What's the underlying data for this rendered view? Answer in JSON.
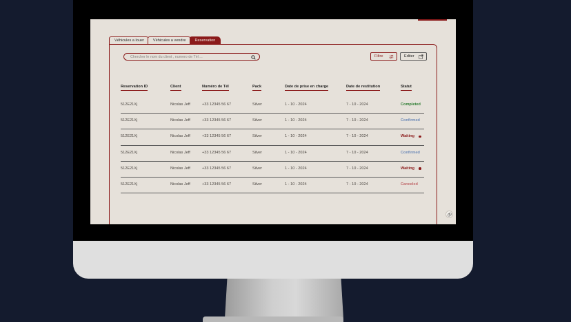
{
  "tabs": [
    {
      "label": "Véhicules a louer",
      "active": false
    },
    {
      "label": "Véhicules a vendre",
      "active": false
    },
    {
      "label": "Reservation",
      "active": true
    }
  ],
  "search": {
    "placeholder": "Chercher le nom du client , numero de Tél ..."
  },
  "toolbar": {
    "filter_label": "Filtre",
    "edit_label": "Editer"
  },
  "table": {
    "headers": [
      "Reservation ID",
      "Client",
      "Numéro de Tél",
      "Pack",
      "Date de prise en charge",
      "Date de restitution",
      "Statut"
    ],
    "rows": [
      {
        "id": "512E21Xj",
        "client": "Nicolas Jeff",
        "phone": "+33 12345 56 67",
        "pack": "Silver",
        "pickup": "1 - 10 - 2024",
        "return": "7 - 10 - 2024",
        "status": "Completed",
        "status_color": "#2e7d32",
        "dot": false
      },
      {
        "id": "512E21Xj",
        "client": "Nicolas Jeff",
        "phone": "+33 12345 56 67",
        "pack": "Silver",
        "pickup": "1 - 10 - 2024",
        "return": "7 - 10 - 2024",
        "status": "Confirmed",
        "status_color": "#6f8bb8",
        "dot": false
      },
      {
        "id": "512E21Xj",
        "client": "Nicolas Jeff",
        "phone": "+33 12345 56 67",
        "pack": "Silver",
        "pickup": "1 - 10 - 2024",
        "return": "7 - 10 - 2024",
        "status": "Waiting",
        "status_color": "#8b1a1a",
        "dot": true
      },
      {
        "id": "512E21Xj",
        "client": "Nicolas Jeff",
        "phone": "+33 12345 56 67",
        "pack": "Silver",
        "pickup": "1 - 10 - 2024",
        "return": "7 - 10 - 2024",
        "status": "Confirmed",
        "status_color": "#6f8bb8",
        "dot": false
      },
      {
        "id": "512E21Xj",
        "client": "Nicolas Jeff",
        "phone": "+33 12345 56 67",
        "pack": "Silver",
        "pickup": "1 - 10 - 2024",
        "return": "7 - 10 - 2024",
        "status": "Waiting",
        "status_color": "#8b1a1a",
        "dot": true
      },
      {
        "id": "512E21Xj",
        "client": "Nicolas Jeff",
        "phone": "+33 12345 56 67",
        "pack": "Silver",
        "pickup": "1 - 10 - 2024",
        "return": "7 - 10 - 2024",
        "status": "Canceled",
        "status_color": "#c0686a",
        "dot": false
      }
    ]
  },
  "colors": {
    "accent": "#8b1a1a",
    "background": "#e6e1da"
  },
  "icons": {
    "search": "search-icon",
    "filter": "sliders-icon",
    "edit": "external-edit-icon",
    "floating": "copy-icon"
  }
}
